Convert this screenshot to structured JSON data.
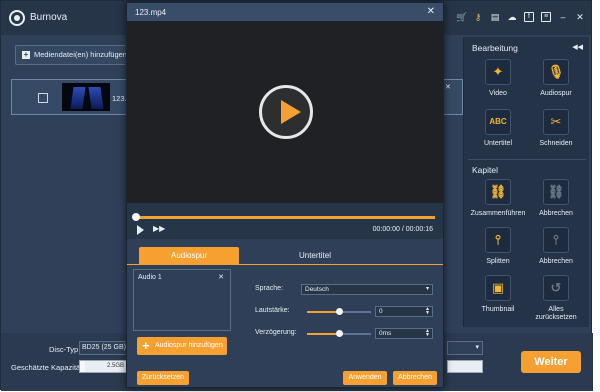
{
  "app": {
    "title": "Burnova",
    "toolbar_icons": [
      "cart-icon",
      "key-icon",
      "document-icon",
      "chat-icon",
      "facebook-icon",
      "menu-icon",
      "minimize-icon",
      "close-icon"
    ],
    "add_media_label": "Mediendatei(en) hinzufügen",
    "file": {
      "name": "123.mp4"
    },
    "bottom": {
      "disc_type_label": "Disc-Typ",
      "disc_type_value": "BD25 (25 GB)",
      "capacity_label": "Geschätzte Kapazität:",
      "capacity_value": "2.5GB",
      "capacity_fraction": 0.1
    },
    "weiter_label": "Weiter"
  },
  "side_panel": {
    "edit_title": "Bearbeitung",
    "edit_tools": [
      {
        "label": "Video",
        "icon": "magic-wand-icon",
        "enabled": true
      },
      {
        "label": "Audiospur",
        "icon": "microphone-icon",
        "enabled": true
      },
      {
        "label": "Untertitel",
        "icon": "abc-icon",
        "enabled": true
      },
      {
        "label": "Schneiden",
        "icon": "scissors-icon",
        "enabled": true
      }
    ],
    "chapter_title": "Kapitel",
    "chapter_tools": [
      {
        "label": "Zusammenführen",
        "icon": "link-icon",
        "enabled": true
      },
      {
        "label": "Abbrechen",
        "icon": "unlink-icon",
        "enabled": false
      },
      {
        "label": "Splitten",
        "icon": "split-icon",
        "enabled": true
      },
      {
        "label": "Abbrechen",
        "icon": "unsplit-icon",
        "enabled": false
      },
      {
        "label": "Thumbnail",
        "icon": "thumbnail-icon",
        "enabled": true
      },
      {
        "label": "Alles zurücksetzen",
        "icon": "reset-icon",
        "enabled": false
      }
    ]
  },
  "modal": {
    "title": "123.mp4",
    "time_current": "00:00:00",
    "time_separator": "/",
    "time_total": "00:00:16",
    "playback_fraction": 0.0,
    "tabs": [
      "Audiospur",
      "Untertitel"
    ],
    "active_tab": "Audiospur",
    "tracks": [
      "Audio 1"
    ],
    "add_track_label": "Audiospur hinzufügen",
    "fields": {
      "language_label": "Sprache:",
      "language_value": "Deutsch",
      "volume_label": "Lautstärke:",
      "volume_value": "0",
      "volume_fraction": 0.5,
      "delay_label": "Verzögerung:",
      "delay_value": "0ms",
      "delay_fraction": 0.5
    },
    "reset_label": "Zurücksetzen",
    "apply_label": "Anwenden",
    "cancel_label": "Abbrechen"
  },
  "colors": {
    "accent": "#f5a031",
    "panel": "#2f4058",
    "dark_panel": "#253349"
  }
}
